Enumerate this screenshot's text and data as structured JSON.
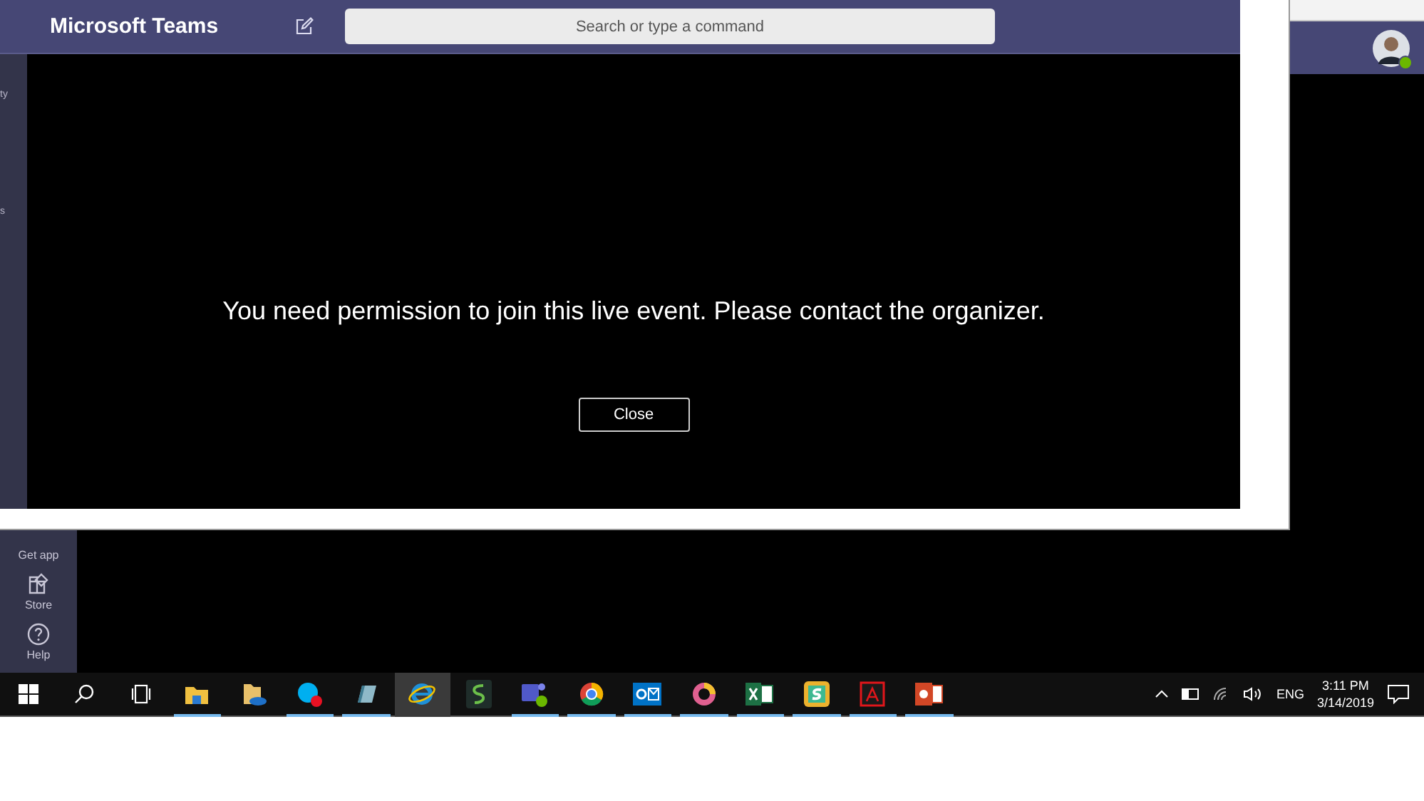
{
  "back_window": {
    "rail_items": [
      {
        "label": "Get app"
      },
      {
        "label": "Store"
      },
      {
        "label": "Help"
      }
    ]
  },
  "front_window": {
    "title": "Microsoft Teams",
    "search": {
      "placeholder": "Search or type a command"
    },
    "rail_fragments": [
      "ty",
      "s"
    ],
    "dialog": {
      "message": "You need permission to join this live event. Please contact the organizer.",
      "button": "Close"
    }
  },
  "taskbar": {
    "apps": [
      {
        "kind": "explorer",
        "running": true,
        "selected": false
      },
      {
        "kind": "onedrive",
        "running": false,
        "selected": false
      },
      {
        "kind": "skype",
        "running": true,
        "selected": false
      },
      {
        "kind": "notes",
        "running": true,
        "selected": false
      },
      {
        "kind": "ie",
        "running": false,
        "selected": true
      },
      {
        "kind": "sway",
        "running": false,
        "selected": false
      },
      {
        "kind": "teams",
        "running": true,
        "selected": false
      },
      {
        "kind": "chrome",
        "running": true,
        "selected": false
      },
      {
        "kind": "outlook",
        "running": true,
        "selected": false
      },
      {
        "kind": "paint",
        "running": true,
        "selected": false
      },
      {
        "kind": "excel",
        "running": true,
        "selected": false
      },
      {
        "kind": "slack",
        "running": true,
        "selected": false
      },
      {
        "kind": "acrobat",
        "running": true,
        "selected": false
      },
      {
        "kind": "powerpoint",
        "running": true,
        "selected": false
      }
    ],
    "language": "ENG",
    "time": "3:11 PM",
    "date": "3/14/2019"
  }
}
